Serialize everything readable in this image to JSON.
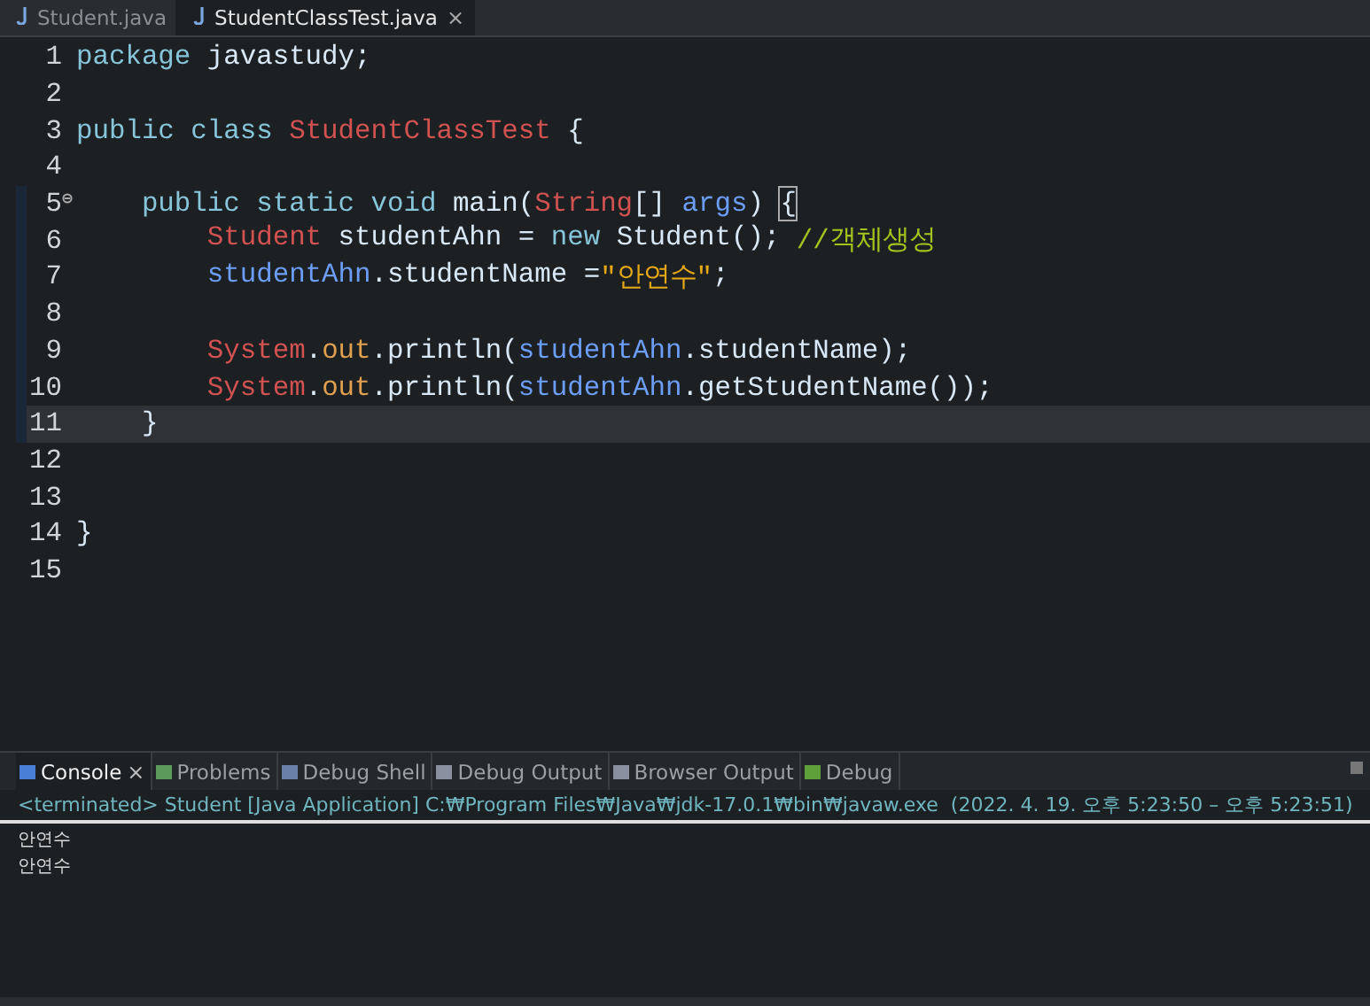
{
  "editor_tabs": [
    {
      "label": "Student.java",
      "selected": false,
      "closable": false
    },
    {
      "label": "StudentClassTest.java",
      "selected": true,
      "closable": true
    }
  ],
  "editor_tab_close": "×",
  "lines": [
    {
      "number": "1",
      "current": false,
      "fold": false,
      "tokens": [
        {
          "kind": "keyword",
          "text": "package"
        },
        {
          "kind": "plain",
          "text": " javastudy;"
        }
      ]
    },
    {
      "number": "2",
      "current": false,
      "fold": false
    },
    {
      "number": "3",
      "current": false,
      "fold": false,
      "tokens": [
        {
          "kind": "keyword",
          "text": "public class"
        },
        {
          "kind": "type",
          "text": " StudentClassTest"
        },
        {
          "kind": "plain",
          "text": " {"
        }
      ]
    },
    {
      "number": "4",
      "current": false,
      "fold": false
    },
    {
      "number": "5",
      "current": false,
      "fold": true,
      "tokens": [
        {
          "kind": "keyword",
          "text": "    public static void"
        },
        {
          "kind": "plain",
          "text": " main("
        },
        {
          "kind": "type",
          "text": "String"
        },
        {
          "kind": "plain",
          "text": "[] "
        },
        {
          "kind": "variable",
          "text": "args"
        },
        {
          "kind": "plain",
          "text": ") "
        },
        {
          "kind": "bracket",
          "text": "{"
        }
      ]
    },
    {
      "number": "6",
      "current": false,
      "fold": false,
      "tokens": [
        {
          "kind": "type",
          "text": "        Student"
        },
        {
          "kind": "plain",
          "text": " studentAhn = "
        },
        {
          "kind": "keyword",
          "text": "new"
        },
        {
          "kind": "plain",
          "text": " Student(); "
        },
        {
          "kind": "comment",
          "text": "//객체생성"
        }
      ]
    },
    {
      "number": "7",
      "current": false,
      "fold": false,
      "tokens": [
        {
          "kind": "variable",
          "text": "        studentAhn"
        },
        {
          "kind": "plain",
          "text": ".studentName ="
        },
        {
          "kind": "string",
          "text": "\"안연수\""
        },
        {
          "kind": "plain",
          "text": ";"
        }
      ]
    },
    {
      "number": "8",
      "current": false,
      "fold": false
    },
    {
      "number": "9",
      "current": false,
      "fold": false,
      "tokens": [
        {
          "kind": "type",
          "text": "        System"
        },
        {
          "kind": "plain",
          "text": "."
        },
        {
          "kind": "static",
          "text": "out"
        },
        {
          "kind": "plain",
          "text": ".println("
        },
        {
          "kind": "variable",
          "text": "studentAhn"
        },
        {
          "kind": "plain",
          "text": ".studentName);"
        }
      ]
    },
    {
      "number": "10",
      "current": false,
      "fold": false,
      "tokens": [
        {
          "kind": "type",
          "text": "        System"
        },
        {
          "kind": "plain",
          "text": "."
        },
        {
          "kind": "static",
          "text": "out"
        },
        {
          "kind": "plain",
          "text": ".println("
        },
        {
          "kind": "variable",
          "text": "studentAhn"
        },
        {
          "kind": "plain",
          "text": ".getStudentName());"
        }
      ]
    },
    {
      "number": "11",
      "current": true,
      "fold": false,
      "tokens": [
        {
          "kind": "plain",
          "text": "    }"
        }
      ]
    },
    {
      "number": "12",
      "current": false,
      "fold": false
    },
    {
      "number": "13",
      "current": false,
      "fold": false
    },
    {
      "number": "14",
      "current": false,
      "fold": false,
      "tokens": [
        {
          "kind": "plain",
          "text": "}"
        }
      ]
    },
    {
      "number": "15",
      "current": false,
      "fold": false
    }
  ],
  "console": {
    "tabs": [
      {
        "label": "Console",
        "selected": true,
        "closable": true,
        "kind": "console"
      },
      {
        "label": "Problems",
        "selected": false,
        "closable": false,
        "kind": "problems"
      },
      {
        "label": "Debug Shell",
        "selected": false,
        "closable": false,
        "kind": "shell"
      },
      {
        "label": "Debug Output",
        "selected": false,
        "closable": false,
        "kind": "output"
      },
      {
        "label": "Browser Output",
        "selected": false,
        "closable": false,
        "kind": "output"
      },
      {
        "label": "Debug",
        "selected": false,
        "closable": false,
        "kind": "debug"
      }
    ],
    "close": "×",
    "header": "<terminated> Student [Java Application] C:₩Program Files₩Java₩jdk-17.0.1₩bin₩javaw.exe  (2022. 4. 19. 오후 5:23:50 – 오후 5:23:51)",
    "output": [
      "안연수",
      "안연수"
    ]
  }
}
